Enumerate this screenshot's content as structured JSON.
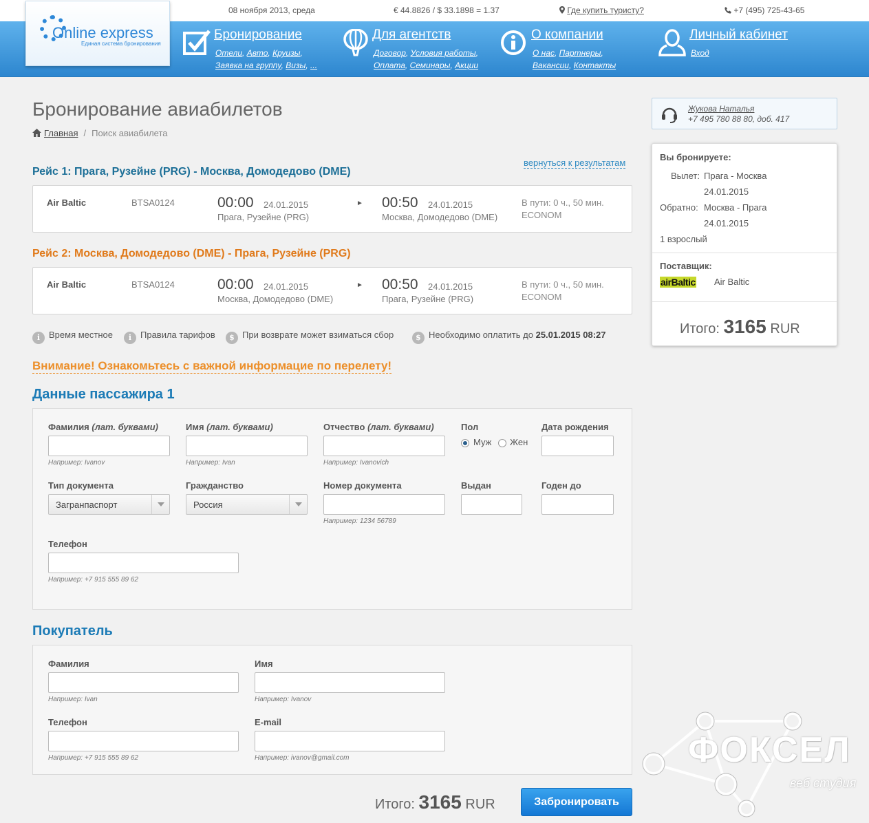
{
  "topbar": {
    "date": "08 ноября 2013, среда",
    "rates": "€ 44.8826 / $ 33.1898 = 1.37",
    "where_link": "Где купить туристу?",
    "phone": "+7 (495) 725-43-65"
  },
  "logo": {
    "name": "Online express",
    "subtitle": "Единая система бронирования"
  },
  "menu": [
    {
      "title": "Бронирование",
      "links": [
        "Отели",
        "Авто",
        "Круизы",
        "Заявка на группу",
        "Визы",
        "..."
      ]
    },
    {
      "title": "Для агентств",
      "links": [
        "Договор",
        "Условия работы",
        "Оплата",
        "Семинары",
        "Акции"
      ]
    },
    {
      "title": "О компании",
      "links": [
        "О нас",
        "Партнеры",
        "Вакансии",
        "Контакты"
      ]
    },
    {
      "title": "Личный кабинет",
      "links": [
        "Вход"
      ]
    }
  ],
  "page": {
    "title": "Бронирование авиабилетов",
    "breadcrumb_home": "Главная",
    "breadcrumb_current": "Поиск авиабилета",
    "back_link": "вернуться к результатам"
  },
  "flights": [
    {
      "heading": "Рейс 1: Прага, Рузейне (PRG) - Москва, Домодедово (DME)",
      "airline": "Air Baltic",
      "code": "BTSA0124",
      "dep_time": "00:00",
      "dep_date": "24.01.2015",
      "dep_place": "Прага, Рузейне (PRG)",
      "arr_time": "00:50",
      "arr_date": "24.01.2015",
      "arr_place": "Москва, Домодедово (DME)",
      "duration": "В пути: 0 ч., 50 мин.",
      "class": "ECONOM"
    },
    {
      "heading": "Рейс 2: Москва, Домодедово (DME) - Прага, Рузейне (PRG)",
      "airline": "Air Baltic",
      "code": "BTSA0124",
      "dep_time": "00:00",
      "dep_date": "24.01.2015",
      "dep_place": "Москва, Домодедово (DME)",
      "arr_time": "00:50",
      "arr_date": "24.01.2015",
      "arr_place": "Прага, Рузейне (PRG)",
      "duration": "В пути: 0 ч., 50 мин.",
      "class": "ECONOM"
    }
  ],
  "info": {
    "local_time": "Время местное",
    "tariff_rules": "Правила тарифов",
    "refund_fee": "При возврате может взиматься сбор",
    "pay_before": "Необходимо оплатить до",
    "pay_deadline": "25.01.2015 08:27"
  },
  "warning": "Внимание! Ознакомьтесь с важной информацие по перелету!",
  "passenger": {
    "title": "Данные пассажира 1",
    "lat_hint": "(лат. буквами)",
    "surname_label": "Фамилия",
    "surname_hint": "Например: Ivanov",
    "name_label": "Имя",
    "name_hint": "Например: Ivan",
    "patronymic_label": "Отчество",
    "patronymic_hint": "Например: Ivanovich",
    "gender_label": "Пол",
    "gender_male": "Муж",
    "gender_female": "Жен",
    "birth_label": "Дата рождения",
    "doc_type_label": "Тип документа",
    "doc_type_value": "Загранпаспорт",
    "citizenship_label": "Гражданство",
    "citizenship_value": "Россия",
    "doc_number_label": "Номер документа",
    "doc_number_hint": "Например: 1234 56789",
    "issued_label": "Выдан",
    "valid_label": "Годен до",
    "phone_label": "Телефон",
    "phone_hint": "Например: +7 915 555 89 62"
  },
  "buyer": {
    "title": "Покупатель",
    "surname_label": "Фамилия",
    "surname_hint": "Например: Ivan",
    "name_label": "Имя",
    "name_hint": "Например: Ivanov",
    "phone_label": "Телефон",
    "phone_hint": "Например: +7 915 555 89 62",
    "email_label": "E-mail",
    "email_hint": "Например: ivanov@gmail.com"
  },
  "sidebar": {
    "manager_name": "Жукова Наталья",
    "manager_phone": "+7 495 780 88 80, доб. 417",
    "booking_title": "Вы бронируете:",
    "departure_label": "Вылет:",
    "departure_route": "Прага - Москва",
    "departure_date": "24.01.2015",
    "return_label": "Обратно:",
    "return_route": "Москва - Прага",
    "return_date": "24.01.2015",
    "passengers": "1 взрослый",
    "supplier_label": "Поставщик:",
    "supplier_logo": "airBaltic",
    "supplier_name": "Air Baltic",
    "total_label": "Итого:",
    "total_value": "3165",
    "currency": "RUR"
  },
  "footer": {
    "total_label": "Итого:",
    "total_value": "3165",
    "currency": "RUR",
    "book_button": "Забронировать"
  },
  "watermark": {
    "text": "ФОКСЕЛ",
    "subtitle": "веб студия"
  },
  "colors": {
    "header_blue": "#2d86cf",
    "title_blue": "#1c7bb6",
    "orange": "#e07a1b",
    "button_blue": "#1477d4"
  },
  "icons": [
    "checkbox-icon",
    "balloon-icon",
    "info-icon",
    "user-icon",
    "home-icon",
    "location-pin-icon",
    "phone-icon",
    "headset-icon"
  ]
}
